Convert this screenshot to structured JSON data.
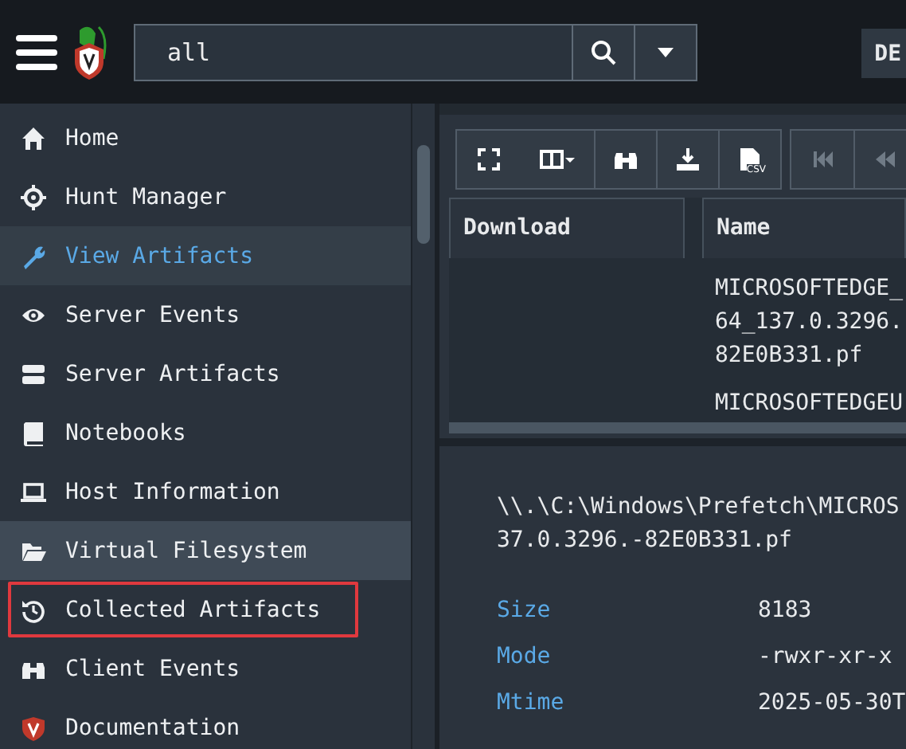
{
  "top_bar": {
    "search": {
      "value": "all"
    },
    "org_button": "DE"
  },
  "sidebar": {
    "items": [
      {
        "label": "Home",
        "selected": false,
        "hovered": false,
        "highlighted": false
      },
      {
        "label": "Hunt Manager",
        "selected": false,
        "hovered": false,
        "highlighted": false
      },
      {
        "label": "View Artifacts",
        "selected": true,
        "hovered": false,
        "highlighted": false
      },
      {
        "label": "Server Events",
        "selected": false,
        "hovered": false,
        "highlighted": false
      },
      {
        "label": "Server Artifacts",
        "selected": false,
        "hovered": false,
        "highlighted": false
      },
      {
        "label": "Notebooks",
        "selected": false,
        "hovered": false,
        "highlighted": false
      },
      {
        "label": "Host Information",
        "selected": false,
        "hovered": false,
        "highlighted": false
      },
      {
        "label": "Virtual Filesystem",
        "selected": false,
        "hovered": true,
        "highlighted": false
      },
      {
        "label": "Collected Artifacts",
        "selected": false,
        "hovered": false,
        "highlighted": true
      },
      {
        "label": "Client Events",
        "selected": false,
        "hovered": false,
        "highlighted": false
      },
      {
        "label": "Documentation",
        "selected": false,
        "hovered": false,
        "highlighted": false
      }
    ]
  },
  "toolbar": {
    "groups": [
      {
        "buttons": [
          {
            "disabled": false
          },
          {
            "disabled": false
          },
          {
            "disabled": false
          },
          {
            "disabled": false
          },
          {
            "disabled": false,
            "label": "CSV"
          }
        ]
      },
      {
        "buttons": [
          {
            "disabled": true
          },
          {
            "disabled": true
          }
        ]
      }
    ]
  },
  "table": {
    "columns": [
      "Download",
      "Name"
    ],
    "rows": [
      {
        "name": [
          "MICROSOFTEDGE_",
          "64_137.0.3296.",
          "82E0B331.pf"
        ]
      },
      {
        "name": [
          "MICROSOFTEDGEU"
        ]
      }
    ]
  },
  "details": {
    "path": [
      "\\\\.\\C:\\Windows\\Prefetch\\MICROS",
      "37.0.3296.-82E0B331.pf"
    ],
    "fields": [
      {
        "label": "Size",
        "value": "8183"
      },
      {
        "label": "Mode",
        "value": "-rwxr-xr-x"
      },
      {
        "label": "Mtime",
        "value": "2025-05-30T"
      }
    ]
  }
}
